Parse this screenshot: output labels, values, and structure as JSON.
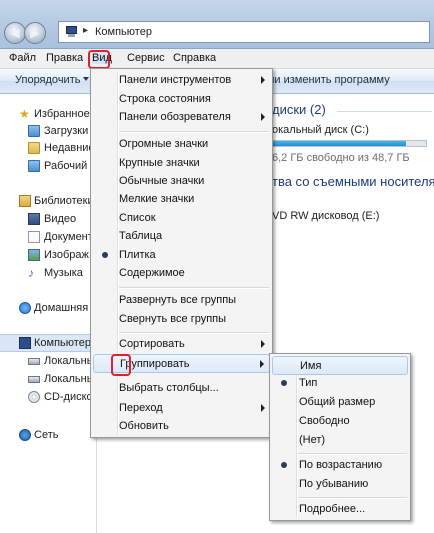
{
  "address": {
    "path": "Компьютер"
  },
  "menubar": {
    "items": [
      {
        "label": "Файл"
      },
      {
        "label": "Правка"
      },
      {
        "label": "Вид"
      },
      {
        "label": "Сервис"
      },
      {
        "label": "Справка"
      }
    ]
  },
  "toolbar": {
    "organize": "Упорядочить",
    "change_program": "ли изменить программу"
  },
  "nav": {
    "favorites": "Избранное",
    "downloads": "Загрузки",
    "recent": "Недавние",
    "desktop": "Рабочий",
    "libraries": "Библиотеки",
    "video": "Видео",
    "documents": "Документ",
    "images": "Изображ",
    "music": "Музыка",
    "homegroup": "Домашняя",
    "computer": "Компьютер",
    "local1": "Локальны",
    "local2": "Локальны",
    "cd": "CD-диско",
    "network": "Сеть"
  },
  "content": {
    "hdd_section": "диски (2)",
    "drive_c_name": "окальный диск (C:)",
    "drive_c_free": "6,2 ГБ свободно из 48,7 ГБ",
    "drive_c_used_fraction": 0.87,
    "removable_section": "тва со съемными носителя",
    "dvd_name": "VD RW дисковод (E:)"
  },
  "view_menu": {
    "items": [
      {
        "label": "Панели инструментов",
        "submenu": true
      },
      {
        "label": "Строка состояния"
      },
      {
        "label": "Панели обозревателя",
        "submenu": true
      },
      {
        "label": "Огромные значки"
      },
      {
        "label": "Крупные значки"
      },
      {
        "label": "Обычные значки"
      },
      {
        "label": "Мелкие значки"
      },
      {
        "label": "Список"
      },
      {
        "label": "Таблица"
      },
      {
        "label": "Плитка",
        "checked": true
      },
      {
        "label": "Содержимое"
      },
      {
        "label": "Развернуть все группы"
      },
      {
        "label": "Свернуть все группы"
      },
      {
        "label": "Сортировать",
        "submenu": true
      },
      {
        "label": "Группировать",
        "submenu": true,
        "hover": true
      },
      {
        "label": "Выбрать столбцы..."
      },
      {
        "label": "Переход",
        "submenu": true
      },
      {
        "label": "Обновить"
      }
    ]
  },
  "group_menu": {
    "items": [
      {
        "label": "Имя",
        "hover": true
      },
      {
        "label": "Тип",
        "checked": true
      },
      {
        "label": "Общий размер"
      },
      {
        "label": "Свободно"
      },
      {
        "label": "(Нет)"
      },
      {
        "label": "По возрастанию",
        "checked": true
      },
      {
        "label": "По убыванию"
      },
      {
        "label": "Подробнее..."
      }
    ]
  },
  "colors": {
    "highlight_box": "#e0202d",
    "accent": "#1e3c78",
    "drive_fill": "#1f8fd1"
  }
}
